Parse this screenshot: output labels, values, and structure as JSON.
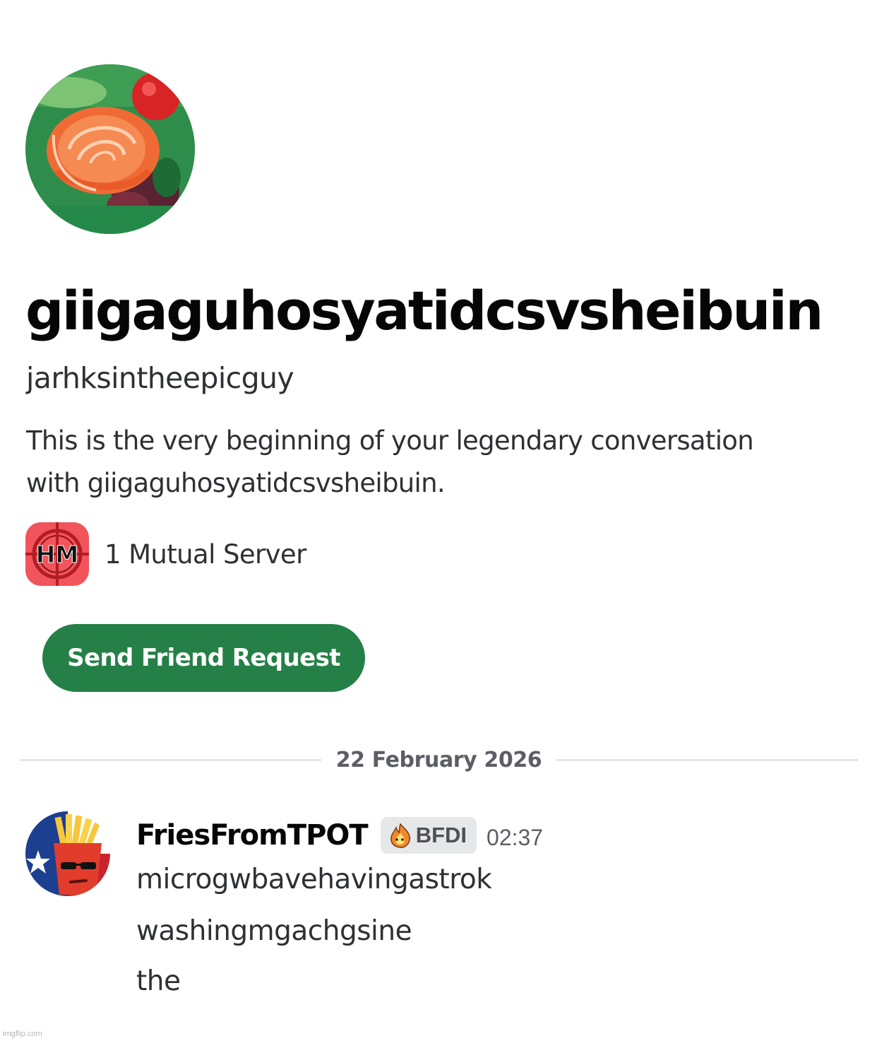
{
  "profile": {
    "avatar_icon": "salmon-sashimi-avatar",
    "display_name": "giigaguhosyatidcsvsheibuin",
    "username": "jarhksintheepicguy",
    "intro_line_1": "This is the very beginning of your legendary conversation",
    "intro_line_2": "with giigaguhosyatidcsvsheibuin.",
    "mutual_servers_label": "1 Mutual Server",
    "server_icon_text": "HM",
    "send_friend_request_label": "Send Friend Request"
  },
  "divider": {
    "date": "22 February 2026"
  },
  "message": {
    "author": "FriesFromTPOT",
    "role_tag": "BFDI",
    "role_icon": "flame-icon",
    "timestamp": "02:37",
    "lines": [
      "microgwbavehavingastrok",
      "washingmgachgsine",
      "the"
    ]
  },
  "watermark": "imgflip.com",
  "colors": {
    "button_green": "#248046",
    "text_primary": "#060607",
    "text_secondary": "#2e3035",
    "muted": "#5c5e66",
    "divider": "#e3e5e8",
    "role_tag_bg": "#e6e7e9",
    "server_icon_bg": "#f1545a"
  }
}
